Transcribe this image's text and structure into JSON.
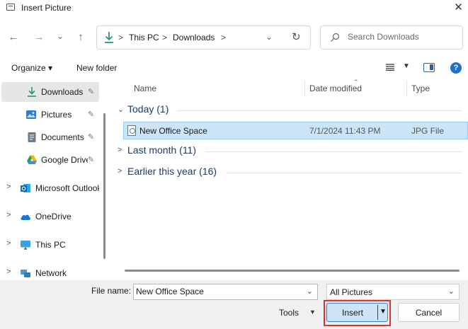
{
  "window": {
    "title": "Insert Picture",
    "close_glyph": "✕"
  },
  "nav": {
    "back_glyph": "←",
    "forward_glyph": "→",
    "recent_glyph": "⌄",
    "up_glyph": "↑",
    "breadcrumb": [
      "This PC",
      "Downloads"
    ],
    "breadcrumb_sep": ">",
    "search_placeholder": "Search Downloads"
  },
  "commandbar": {
    "organize_label": "Organize ▾",
    "new_folder_label": "New folder",
    "help_label": "?"
  },
  "sidebar": {
    "items": [
      {
        "label": "Downloads",
        "icon": "download-icon",
        "pinned": true
      },
      {
        "label": "Pictures",
        "icon": "pictures-icon",
        "pinned": true
      },
      {
        "label": "Documents",
        "icon": "documents-icon",
        "pinned": true
      },
      {
        "label": "Google Drive",
        "icon": "google-drive-icon",
        "pinned": true
      },
      {
        "label": "Microsoft Outlook",
        "icon": "outlook-icon",
        "pinned": false
      },
      {
        "label": "OneDrive",
        "icon": "onedrive-icon",
        "pinned": false
      },
      {
        "label": "This PC",
        "icon": "this-pc-icon",
        "pinned": false
      },
      {
        "label": "Network",
        "icon": "network-icon",
        "pinned": false
      }
    ],
    "pin_glyph": "📌",
    "expand_glyph": ">"
  },
  "filelist": {
    "columns": [
      "Name",
      "Date modified",
      "Type"
    ],
    "groups": [
      {
        "label": "Today (1)",
        "expanded": true
      },
      {
        "label": "Last month (11)",
        "expanded": false
      },
      {
        "label": "Earlier this year (16)",
        "expanded": false
      }
    ],
    "files": [
      {
        "name": "New Office Space",
        "date_modified": "7/1/2024 11:43 PM",
        "type": "JPG File",
        "selected": true
      }
    ]
  },
  "footer": {
    "file_name_label": "File name:",
    "file_name_value": "New Office Space",
    "filter_value": "All Pictures",
    "tools_label": "Tools",
    "insert_label": "Insert",
    "cancel_label": "Cancel"
  },
  "colors": {
    "accent": "#1f6fd1",
    "selection": "#cce4f7",
    "highlight_frame": "#e03131"
  }
}
